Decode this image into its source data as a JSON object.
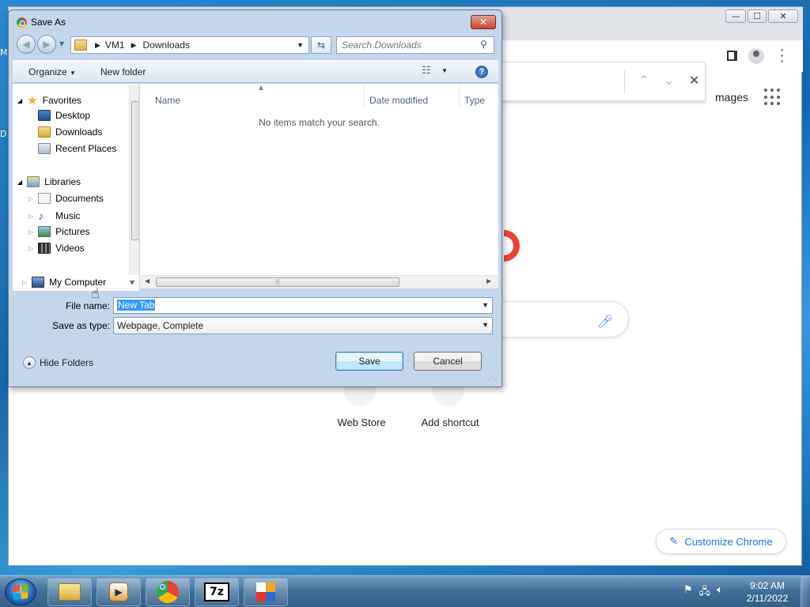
{
  "desktop": {
    "glyph_m": "M",
    "glyph_d": "D"
  },
  "chrome": {
    "window_buttons": {
      "minimize": "—",
      "maximize": "☐",
      "close": "✕"
    },
    "find_bar": {
      "prev": "⌃",
      "next": "⌄",
      "close": "✕"
    },
    "ntp": {
      "images_link": "mages",
      "shortcuts": [
        {
          "label": "Web Store"
        },
        {
          "label": "Add shortcut"
        }
      ],
      "customize_label": "Customize Chrome"
    }
  },
  "dialog": {
    "title": "Save As",
    "close": "✕",
    "address": {
      "root": "VM1",
      "folder": "Downloads"
    },
    "search_placeholder": "Search Downloads",
    "toolbar": {
      "organize": "Organize",
      "new_folder": "New folder",
      "help": "?"
    },
    "nav": {
      "favorites": "Favorites",
      "favorites_items": [
        "Desktop",
        "Downloads",
        "Recent Places"
      ],
      "libraries": "Libraries",
      "libraries_items": [
        "Documents",
        "Music",
        "Pictures",
        "Videos"
      ],
      "computer": "My Computer"
    },
    "columns": [
      "Name",
      "Date modified",
      "Type"
    ],
    "empty_message": "No items match your search.",
    "file_name_label": "File name:",
    "file_name_value": "New Tab",
    "save_type_label": "Save as type:",
    "save_type_value": "Webpage, Complete",
    "hide_folders": "Hide Folders",
    "save_button": "Save",
    "cancel_button": "Cancel"
  },
  "taskbar": {
    "clock_time": "9:02 AM",
    "clock_date": "2/11/2022",
    "apps": [
      "windows-explorer",
      "media-player",
      "google-chrome",
      "7-zip",
      "office"
    ]
  }
}
